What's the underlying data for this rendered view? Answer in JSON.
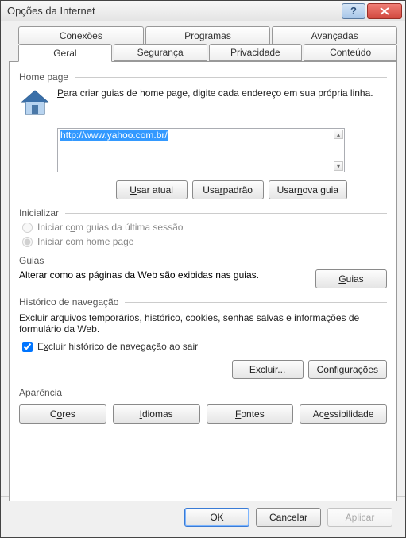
{
  "window": {
    "title": "Opções da Internet"
  },
  "tabs_row1": [
    "Conexões",
    "Programas",
    "Avançadas"
  ],
  "tabs_row2": [
    "Geral",
    "Segurança",
    "Privacidade",
    "Conteúdo"
  ],
  "active_tab": "Geral",
  "homepage": {
    "section_label": "Home page",
    "instruction": "Para criar guias de home page, digite cada endereço em sua própria linha.",
    "url": "http://www.yahoo.com.br/",
    "btn_current": "Usar atual",
    "btn_default": "Usar padrão",
    "btn_newtab": "Usar nova guia"
  },
  "init": {
    "section_label": "Inicializar",
    "opt_last": "Iniciar com guias da última sessão",
    "opt_home": "Iniciar com home page"
  },
  "guias": {
    "section_label": "Guias",
    "text": "Alterar como as páginas da Web são exibidas nas guias.",
    "btn": "Guias"
  },
  "history": {
    "section_label": "Histórico de navegação",
    "text": "Excluir arquivos temporários, histórico, cookies, senhas salvas e informações de formulário da Web.",
    "chk_label": "Excluir histórico de navegação ao sair",
    "btn_delete": "Excluir...",
    "btn_settings": "Configurações"
  },
  "appearance": {
    "section_label": "Aparência",
    "btn_colors": "Cores",
    "btn_lang": "Idiomas",
    "btn_fonts": "Fontes",
    "btn_access": "Acessibilidade"
  },
  "footer": {
    "ok": "OK",
    "cancel": "Cancelar",
    "apply": "Aplicar"
  }
}
